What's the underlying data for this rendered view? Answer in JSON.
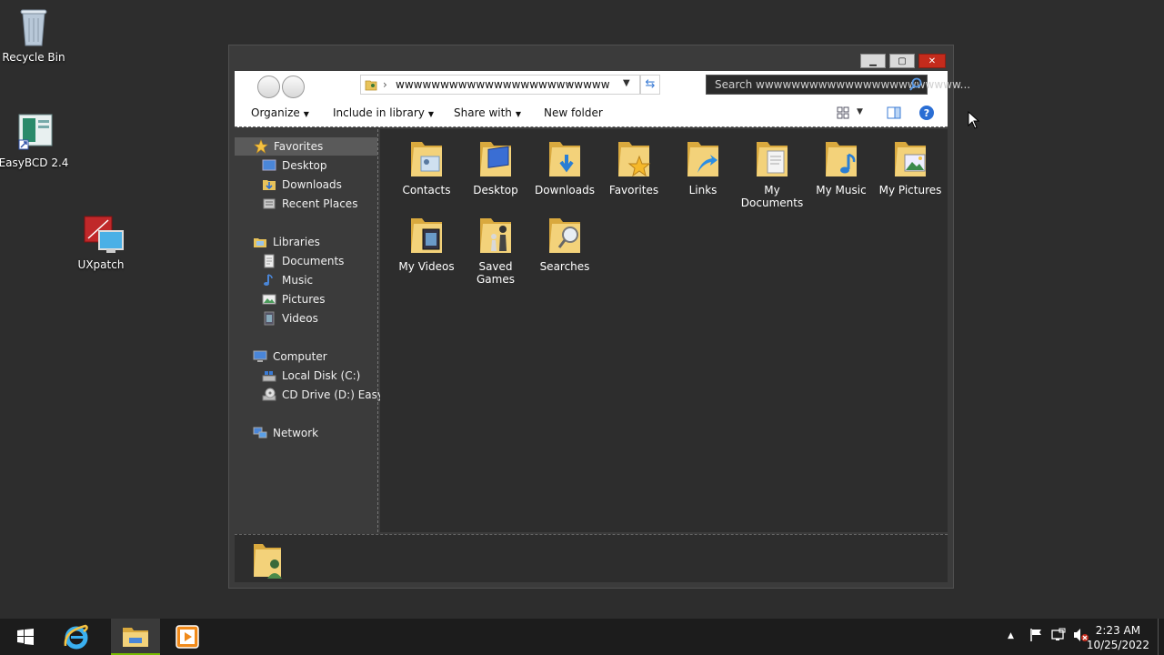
{
  "desktop": {
    "icons": [
      {
        "label": "Recycle Bin"
      },
      {
        "label": "EasyBCD 2.4"
      },
      {
        "label": "UXpatch"
      }
    ]
  },
  "window": {
    "controls": {
      "minimize": "▁",
      "maximize": "▢",
      "close": "✕"
    },
    "address": {
      "path": "wwwwwwwwwwwwwwwwwwwwwwww",
      "separator": "›"
    },
    "search": {
      "placeholder": "Search wwwwwwwwwwwwwwwwwwwwwww..."
    },
    "commands": {
      "organize": "Organize",
      "include": "Include in library",
      "share": "Share with",
      "new_folder": "New folder"
    },
    "nav": {
      "favorites": {
        "label": "Favorites",
        "items": [
          "Desktop",
          "Downloads",
          "Recent Places"
        ]
      },
      "libraries": {
        "label": "Libraries",
        "items": [
          "Documents",
          "Music",
          "Pictures",
          "Videos"
        ]
      },
      "computer": {
        "label": "Computer",
        "items": [
          "Local Disk (C:)",
          "CD Drive (D:) EasyBC"
        ]
      },
      "network": {
        "label": "Network"
      }
    },
    "folders": [
      {
        "line1": "Contacts",
        "line2": ""
      },
      {
        "line1": "Desktop",
        "line2": ""
      },
      {
        "line1": "Downloads",
        "line2": ""
      },
      {
        "line1": "Favorites",
        "line2": ""
      },
      {
        "line1": "Links",
        "line2": ""
      },
      {
        "line1": "My",
        "line2": "Documents"
      },
      {
        "line1": "My Music",
        "line2": ""
      },
      {
        "line1": "My Pictures",
        "line2": ""
      },
      {
        "line1": "My Videos",
        "line2": ""
      },
      {
        "line1": "Saved",
        "line2": "Games"
      },
      {
        "line1": "Searches",
        "line2": ""
      }
    ]
  },
  "taskbar": {
    "tray_up": "▲",
    "time": "2:23 AM",
    "date": "10/25/2022"
  },
  "colors": {
    "folder": "#f3d27a",
    "folder_dark": "#d9a93e",
    "accent": "#3a7bd5"
  }
}
